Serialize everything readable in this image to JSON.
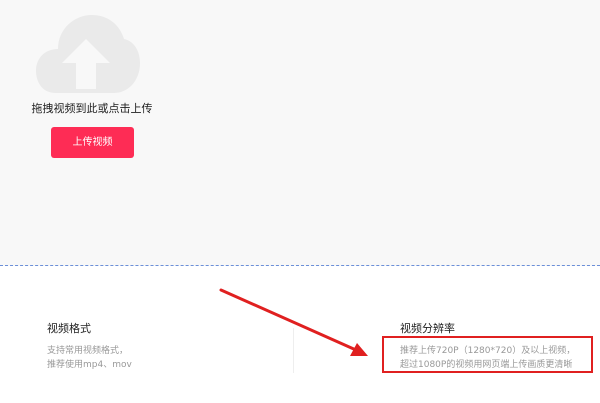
{
  "upload": {
    "hint": "拖拽视频到此或点击上传",
    "button_label": "上传视频",
    "icon": "cloud-upload-icon"
  },
  "format": {
    "title": "视频格式",
    "lines": [
      "支持常用视频格式，",
      "推荐使用mp4、mov"
    ]
  },
  "resolution": {
    "title": "视频分辨率",
    "lines": [
      "推荐上传720P（1280*720）及以上视频，",
      "超过1080P的视频用网页端上传画质更清晰"
    ]
  },
  "colors": {
    "accent": "#fe2c55",
    "annotation": "#e02020",
    "dashed_border": "#6b8fd8",
    "upload_bg": "#f8f8f8"
  }
}
